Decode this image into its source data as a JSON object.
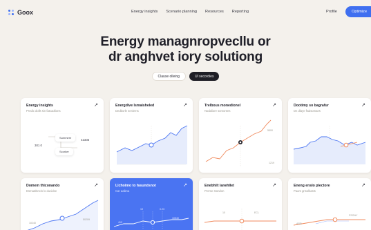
{
  "nav": {
    "logo": "Goox",
    "links": [
      "Energy insights",
      "Scenario planning",
      "Resources",
      "Reporting"
    ],
    "profile": "Profile",
    "cta": "Optimize"
  },
  "hero": {
    "line1": "Energy managnropvecllu or",
    "line2": "dr anghvet iory solutiong",
    "pills": [
      "Clause olleing",
      "Ul secordies"
    ]
  },
  "cards": [
    {
      "title": "Energy insights",
      "subtitle": "Predic dolls sin fatcadtions",
      "tags": [
        "Summere",
        "Scorker"
      ],
      "stats": [
        "301 0",
        "42335"
      ]
    },
    {
      "title": "Energdive lsmaisheled",
      "subtitle": "Dedborle seniems"
    },
    {
      "title": "Trelbous monedionel",
      "subtitle": "Nodaliore somorees",
      "ticks": [
        "5500",
        "1219"
      ]
    },
    {
      "title": "Dootimy so bagrafur",
      "subtitle": "Dn dlaye fsaisomans"
    },
    {
      "title": "Domem thiconando",
      "subtitle": "Dsmatdsncis lo ducidee",
      "ticks": [
        "10240",
        "50209"
      ]
    },
    {
      "title": "Llchoimo to fasundsnot",
      "subtitle": "Car aalima",
      "ticks": [
        "19",
        "0.23",
        "412",
        "10540"
      ]
    },
    {
      "title": "Enebhilt lanehllet",
      "subtitle": "Perme stondon",
      "ticks": [
        "10",
        "ECL"
      ]
    },
    {
      "title": "Eneng enslo plectore",
      "subtitle": "Paam gnsolkasts",
      "ticks": [
        "ARR",
        "FSONY"
      ]
    }
  ],
  "colors": {
    "accent": "#3f6ff0",
    "orange": "#f08a5d",
    "background": "#f4f1ec"
  }
}
